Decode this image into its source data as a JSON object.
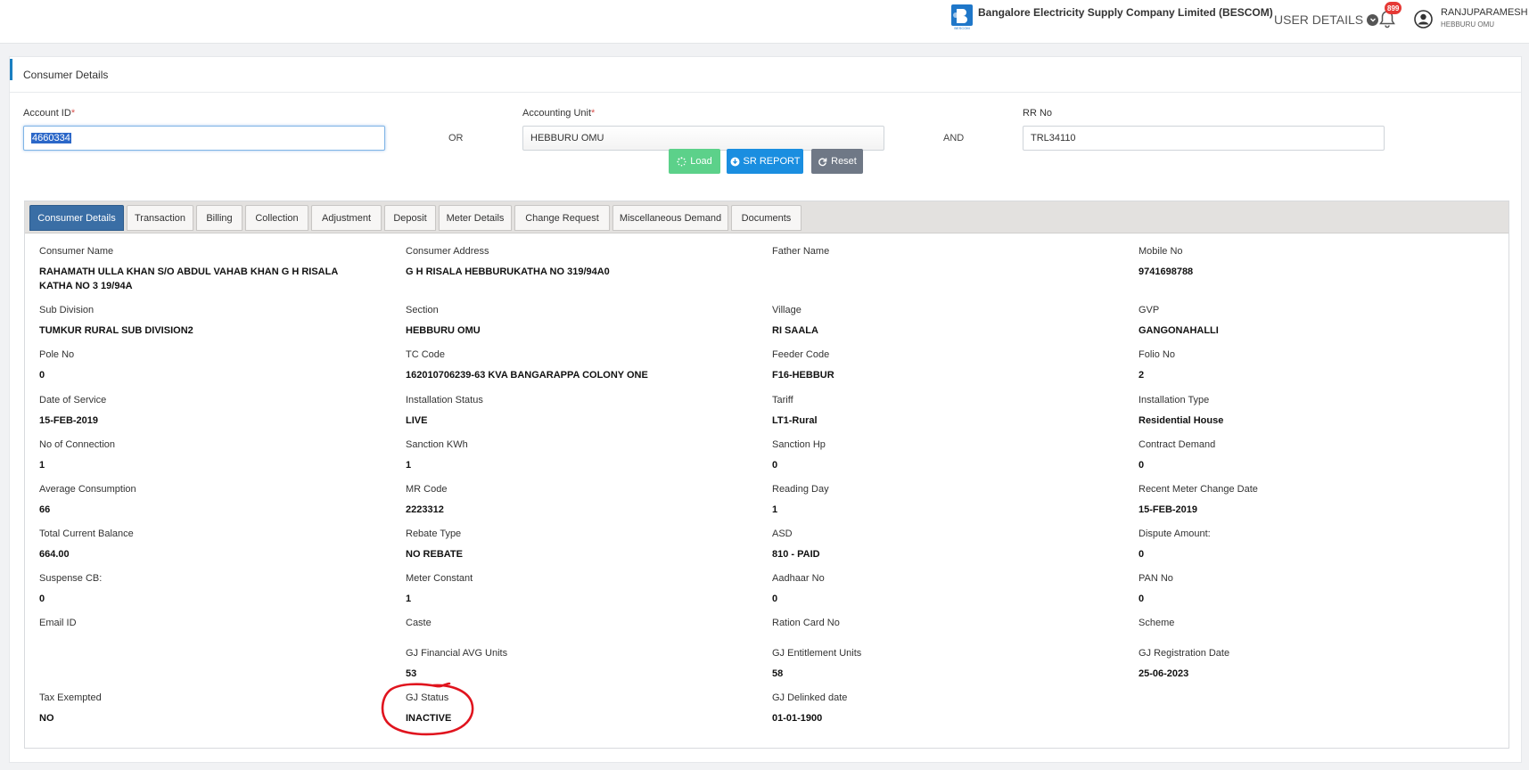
{
  "header": {
    "company_name": "Bangalore Electricity Supply Company Limited (BESCOM)",
    "user_details_label": "USER DETAILS",
    "notification_count": "899",
    "user_name": "RANJUPARAMESH",
    "user_unit": "HEBBURU OMU",
    "logo_caption": "BESCOM"
  },
  "card": {
    "title": "Consumer Details"
  },
  "search": {
    "account_id_label": "Account ID",
    "account_id_value": "4660334",
    "or_label": "OR",
    "accounting_unit_label": "Accounting Unit",
    "accounting_unit_value": "HEBBURU OMU",
    "and_label": "AND",
    "rr_no_label": "RR No",
    "rr_no_value": "TRL34110",
    "required_mark": "*"
  },
  "buttons": {
    "load": "Load",
    "sr_report": "SR REPORT",
    "reset": "Reset"
  },
  "tabs": [
    "Consumer Details",
    "Transaction",
    "Billing",
    "Collection",
    "Adjustment",
    "Deposit",
    "Meter Details",
    "Change Request",
    "Miscellaneous Demand",
    "Documents"
  ],
  "active_tab": "Consumer Details",
  "details": [
    {
      "label": "Consumer Name",
      "value": "RAHAMATH ULLA KHAN S/O ABDUL VAHAB KHAN G H RISALA KATHA NO 3 19/94A"
    },
    {
      "label": "Consumer Address",
      "value": "G H RISALA HEBBURUKATHA NO 319/94A0"
    },
    {
      "label": "Father Name",
      "value": ""
    },
    {
      "label": "Mobile No",
      "value": "9741698788"
    },
    {
      "label": "Sub Division",
      "value": "TUMKUR RURAL SUB DIVISION2"
    },
    {
      "label": "Section",
      "value": "HEBBURU OMU"
    },
    {
      "label": "Village",
      "value": "RI SAALA"
    },
    {
      "label": "GVP",
      "value": "GANGONAHALLI"
    },
    {
      "label": "Pole No",
      "value": "0"
    },
    {
      "label": "TC Code",
      "value": "162010706239-63 KVA BANGARAPPA COLONY ONE"
    },
    {
      "label": "Feeder Code",
      "value": "F16-HEBBUR"
    },
    {
      "label": "Folio No",
      "value": "2"
    },
    {
      "label": "Date of Service",
      "value": "15-FEB-2019"
    },
    {
      "label": "Installation Status",
      "value": "LIVE"
    },
    {
      "label": "Tariff",
      "value": "LT1-Rural"
    },
    {
      "label": "Installation Type",
      "value": "Residential House"
    },
    {
      "label": "No of Connection",
      "value": "1"
    },
    {
      "label": "Sanction KWh",
      "value": "1"
    },
    {
      "label": "Sanction Hp",
      "value": "0"
    },
    {
      "label": "Contract Demand",
      "value": "0"
    },
    {
      "label": "Average Consumption",
      "value": "66"
    },
    {
      "label": "MR Code",
      "value": "2223312"
    },
    {
      "label": "Reading Day",
      "value": "1"
    },
    {
      "label": "Recent Meter Change Date",
      "value": "15-FEB-2019"
    },
    {
      "label": "Total Current Balance",
      "value": "664.00"
    },
    {
      "label": "Rebate Type",
      "value": "NO REBATE"
    },
    {
      "label": "ASD",
      "value": "810 - PAID"
    },
    {
      "label": "Dispute Amount:",
      "value": "0"
    },
    {
      "label": "Suspense CB:",
      "value": "0"
    },
    {
      "label": "Meter Constant",
      "value": "1"
    },
    {
      "label": "Aadhaar No",
      "value": "0"
    },
    {
      "label": "PAN No",
      "value": "0"
    },
    {
      "label": "Email ID",
      "value": ""
    },
    {
      "label": "Caste",
      "value": ""
    },
    {
      "label": "Ration Card No",
      "value": ""
    },
    {
      "label": "Scheme",
      "value": ""
    },
    {
      "label": "",
      "value": ""
    },
    {
      "label": "GJ Financial AVG Units",
      "value": "53"
    },
    {
      "label": "GJ Entitlement Units",
      "value": "58"
    },
    {
      "label": "GJ Registration Date",
      "value": "25-06-2023"
    },
    {
      "label": "Tax Exempted",
      "value": "NO"
    },
    {
      "label": "GJ Status",
      "value": "INACTIVE"
    },
    {
      "label": "GJ Delinked date",
      "value": "01-01-1900"
    }
  ],
  "colors": {
    "accent": "#1a7fc1",
    "active_tab": "#3a6ea5",
    "load_button": "#5cd18a",
    "sr_button": "#1a8ee0",
    "reset_button": "#6f7886",
    "annotation_circle": "#e0141e"
  }
}
